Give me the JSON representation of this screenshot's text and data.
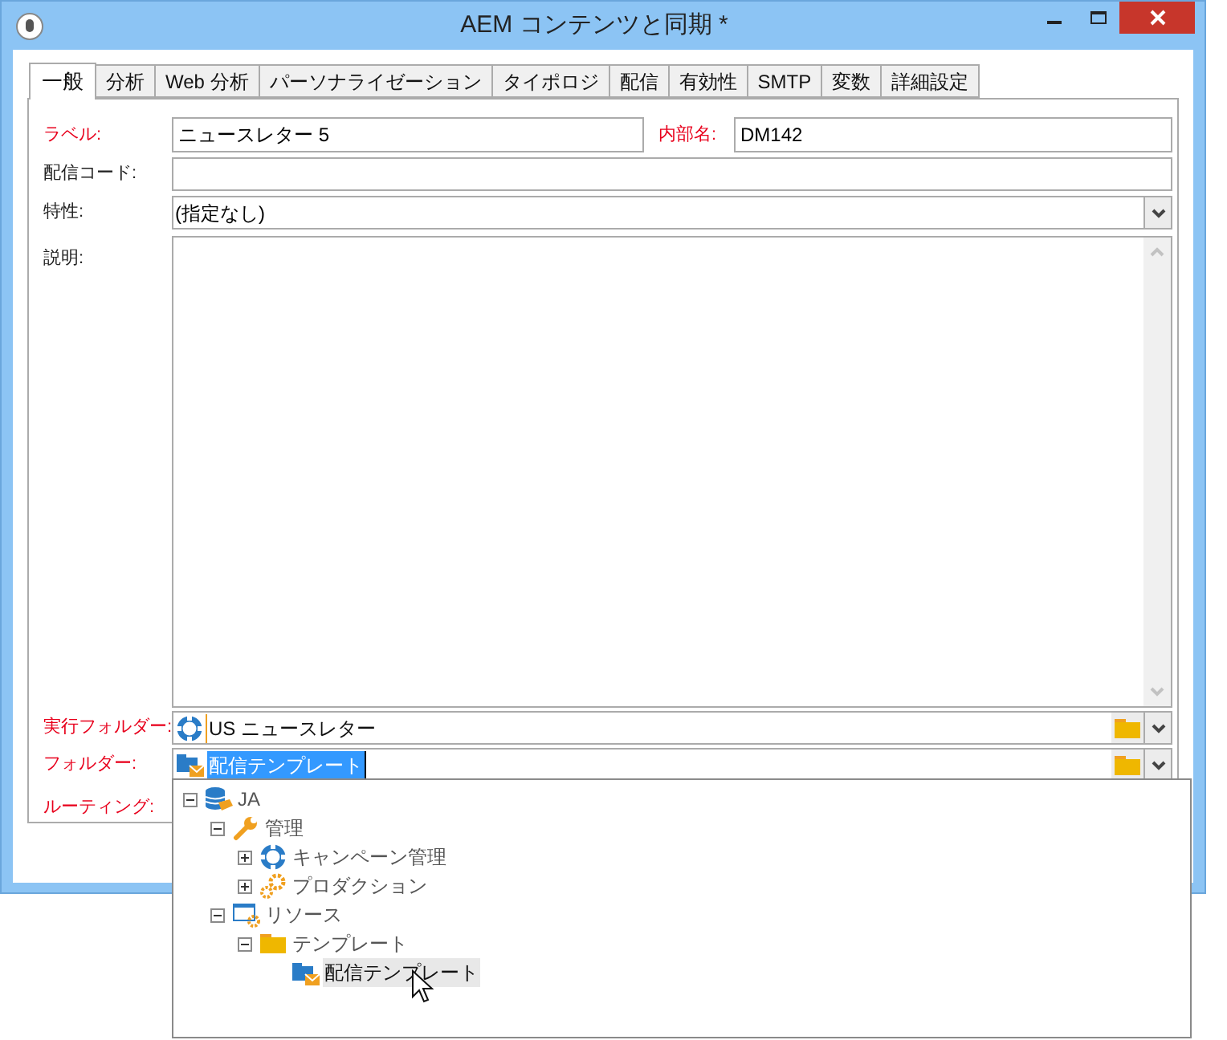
{
  "window": {
    "title": "AEM コンテンツと同期 *"
  },
  "tabs": [
    {
      "label": "一般",
      "selected": true
    },
    {
      "label": "分析",
      "selected": false
    },
    {
      "label": "Web 分析",
      "selected": false
    },
    {
      "label": "パーソナライゼーション",
      "selected": false
    },
    {
      "label": "タイポロジ",
      "selected": false
    },
    {
      "label": "配信",
      "selected": false
    },
    {
      "label": "有効性",
      "selected": false
    },
    {
      "label": "SMTP",
      "selected": false
    },
    {
      "label": "変数",
      "selected": false
    },
    {
      "label": "詳細設定",
      "selected": false
    }
  ],
  "label_field": {
    "label": "ラベル:",
    "required": true,
    "value": "ニュースレター 5"
  },
  "internal_name": {
    "label": "内部名:",
    "required": true,
    "value": "DM142"
  },
  "delivery_code": {
    "label": "配信コード:",
    "required": false
  },
  "nature": {
    "label": "特性:",
    "required": false,
    "value": "(指定なし)"
  },
  "description": {
    "label": "説明:",
    "required": false
  },
  "execution_folder": {
    "label": "実行フォルダー:",
    "required": true,
    "value": "US ニュースレター",
    "kind": "campaign",
    "text_selected": false
  },
  "folder": {
    "label": "フォルダー:",
    "required": true,
    "value": "配信テンプレート",
    "kind": "delivery-folder",
    "text_selected": true
  },
  "routing": {
    "label": "ルーティング:",
    "required": true
  },
  "folder_tree": [
    {
      "label": "JA",
      "kind": "database",
      "expanded": true,
      "selected": false,
      "children": [
        {
          "label": "管理",
          "kind": "wrench",
          "expanded": true,
          "selected": false,
          "children": [
            {
              "label": "キャンペーン管理",
              "kind": "campaign",
              "expanded": false,
              "selected": false
            },
            {
              "label": "プロダクション",
              "kind": "gears",
              "expanded": false,
              "selected": false
            }
          ]
        },
        {
          "label": "リソース",
          "kind": "resources",
          "expanded": true,
          "selected": false,
          "children": [
            {
              "label": "テンプレート",
              "kind": "folder",
              "expanded": true,
              "selected": false,
              "children": [
                {
                  "label": "配信テンプレート",
                  "kind": "delivery-folder",
                  "selected": true
                }
              ]
            }
          ]
        }
      ]
    }
  ]
}
